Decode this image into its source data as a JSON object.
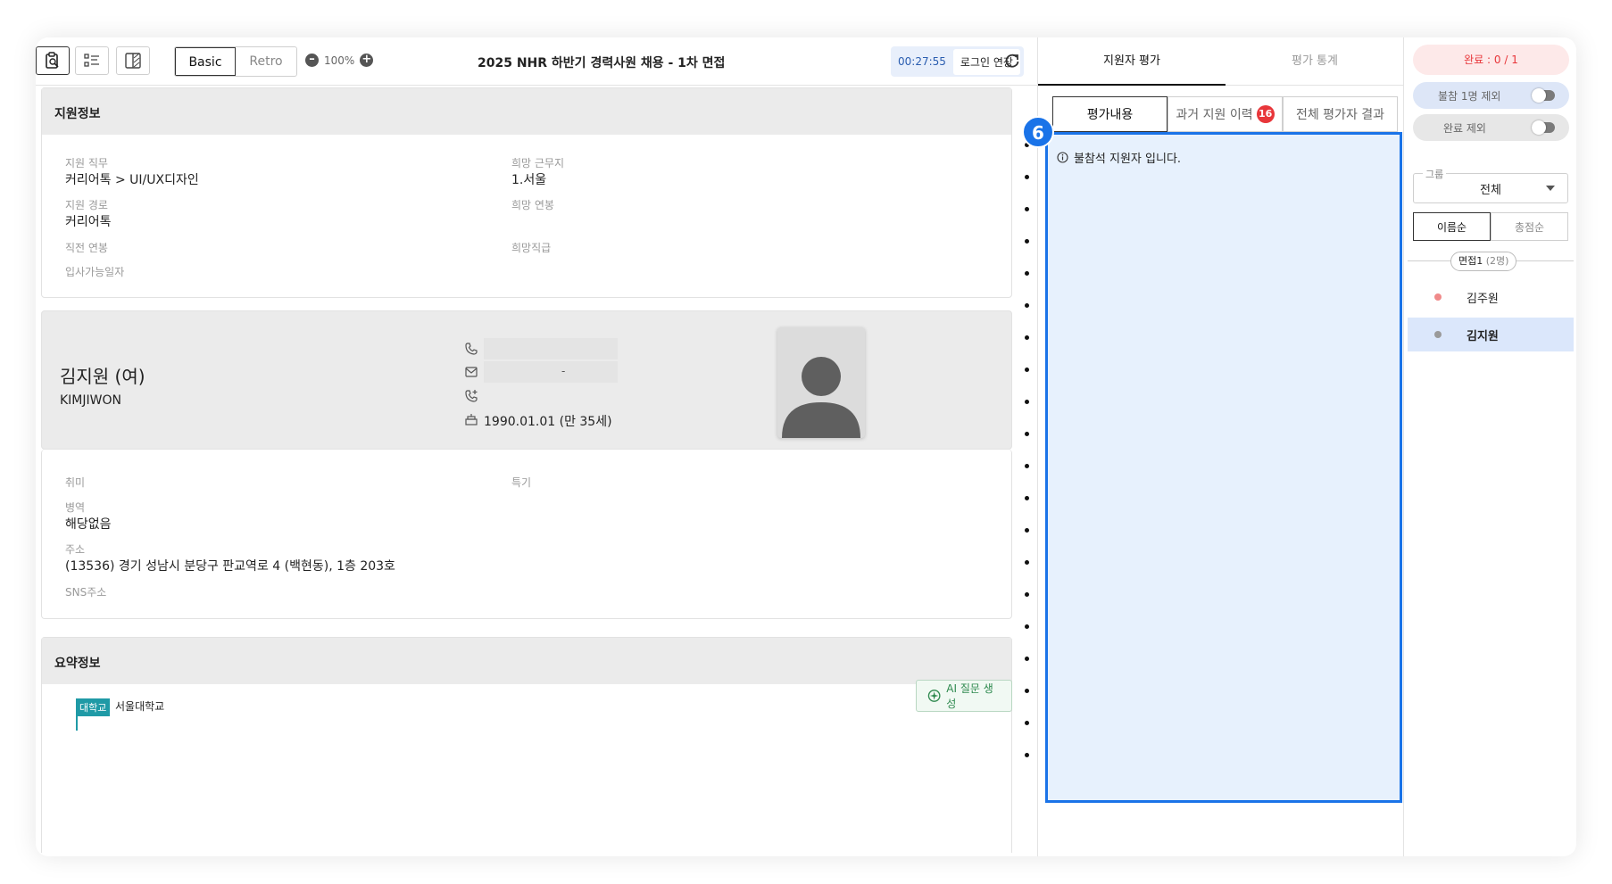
{
  "toolbar": {
    "view_modes": [
      "Basic",
      "Retro"
    ],
    "active_view": "Basic",
    "zoom": "100%",
    "title": "2025 NHR 하반기 경력사원 채용 - 1차 면접",
    "timer": "00:27:55",
    "extend_login": "로그인 연장"
  },
  "application_info": {
    "heading": "지원정보",
    "job_label": "지원 직무",
    "job_value": "커리어톡 > UI/UX디자인",
    "location_label": "희망 근무지",
    "location_value": "1.서울",
    "route_label": "지원 경로",
    "route_value": "커리어톡",
    "salary_label": "희망 연봉",
    "prev_salary_label": "직전 연봉",
    "grade_label": "희망직급",
    "start_date_label": "입사가능일자"
  },
  "profile": {
    "name": "김지원 (여)",
    "name_en": "KIMJIWON",
    "birth": "1990.01.01 (만 35세)",
    "email_masked": "-"
  },
  "personal": {
    "hobby_label": "취미",
    "skill_label": "특기",
    "military_label": "병역",
    "military_value": "해당없음",
    "address_label": "주소",
    "address_value": "(13536) 경기 성남시 분당구 판교역로 4 (백현동), 1층 203호",
    "sns_label": "SNS주소"
  },
  "summary": {
    "heading": "요약정보",
    "school_tag": "대학교",
    "school_name": "서울대학교",
    "ai_button": "AI 질문 생성"
  },
  "evaluation": {
    "tabs": [
      "지원자 평가",
      "평가 통계"
    ],
    "subtabs": [
      "평가내용",
      "과거 지원 이력",
      "전체 평가자 결과"
    ],
    "history_count": "16",
    "notice": "불참석 지원자 입니다.",
    "step_marker": "6"
  },
  "sidebar": {
    "completion": "완료 : 0 / 1",
    "exclude_absent": "불참 1명 제외",
    "exclude_done": "완료 제외",
    "group_label": "그룹",
    "group_value": "전체",
    "sort_options": [
      "이름순",
      "총점순"
    ],
    "interview_group": "면접1",
    "interview_count": "(2명)",
    "candidates": [
      {
        "name": "김주원",
        "color": "#f08a8a"
      },
      {
        "name": "김지원",
        "color": "#9a9a9a"
      }
    ]
  },
  "colors": {
    "accent": "#1a73e8",
    "danger": "#e8363a",
    "school_tag": "#1f9aa6",
    "ai_green": "#2f8a4f"
  }
}
